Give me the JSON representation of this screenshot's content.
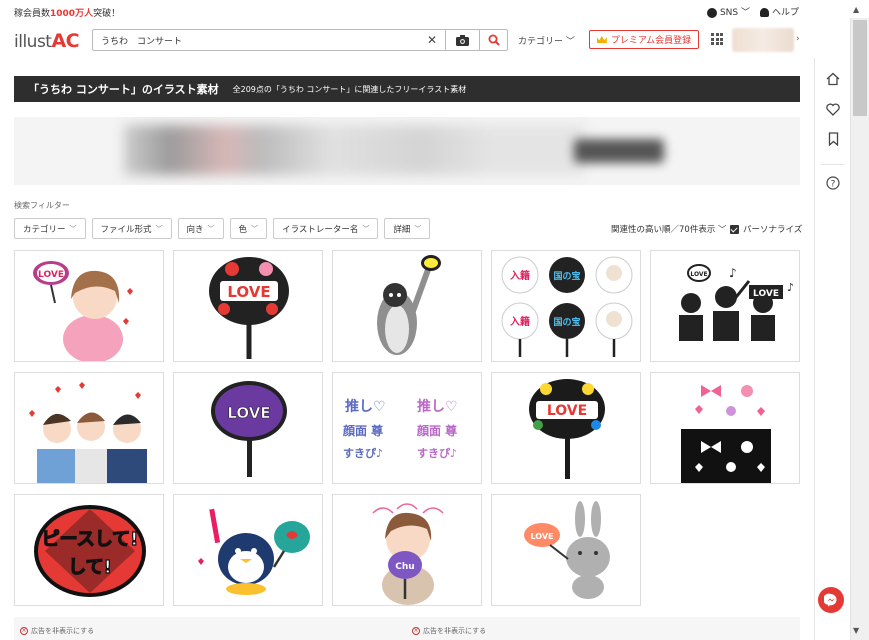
{
  "header": {
    "member_prefix": "稼会員数",
    "member_count": "1000万人",
    "member_suffix": "突破！",
    "sns_label": "SNS",
    "help_label": "ヘルプ",
    "logo_text": "illust",
    "logo_accent": "AC",
    "search_value": "うちわ　コンサート",
    "category_label": "カテゴリー",
    "premium_label": "プレミアム会員登録"
  },
  "heading": {
    "title": "「うちわ コンサート」のイラスト素材",
    "subtitle": "全209点の「うちわ コンサート」に関連したフリーイラスト素材"
  },
  "filters": {
    "label": "検索フィルター",
    "buttons": [
      "カテゴリー",
      "ファイル形式",
      "向き",
      "色",
      "イラストレーター名",
      "詳細"
    ],
    "sort_label": "関連性の高い順／70件表示",
    "personalize_label": "パーソナライズ",
    "personalize_checked": true
  },
  "tiles": [
    {
      "desc": "girl-with-love-fan"
    },
    {
      "desc": "love-uchiwa-hearts",
      "text": "LOVE"
    },
    {
      "desc": "penguin-with-fan"
    },
    {
      "desc": "uchiwa-set-six"
    },
    {
      "desc": "silhouette-crowd",
      "text": "LOVE"
    },
    {
      "desc": "girls-group-hearts"
    },
    {
      "desc": "purple-love-fan",
      "text": "LOVE"
    },
    {
      "desc": "oshi-text-stickers",
      "text": "推し♡"
    },
    {
      "desc": "rainbow-love-fan",
      "text": "LOVE"
    },
    {
      "desc": "decor-stickers-pink-black"
    },
    {
      "desc": "peace-shite-fan",
      "text": "ピースして!"
    },
    {
      "desc": "penguin-cheering"
    },
    {
      "desc": "girl-holding-fan",
      "text": "Chu"
    },
    {
      "desc": "bunny-with-love-fan",
      "text": "LOVE"
    }
  ],
  "ads": {
    "hide_label": "広告を非表示にする"
  },
  "colors": {
    "accent": "#e53935",
    "heading_bg": "#2e2e2e"
  }
}
